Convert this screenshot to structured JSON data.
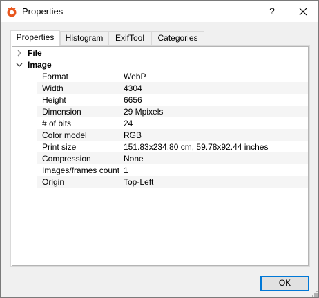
{
  "window": {
    "title": "Properties",
    "help_label": "?"
  },
  "tabs": [
    {
      "label": "Properties"
    },
    {
      "label": "Histogram"
    },
    {
      "label": "ExifTool"
    },
    {
      "label": "Categories"
    }
  ],
  "groups": [
    {
      "label": "File",
      "expanded": false
    },
    {
      "label": "Image",
      "expanded": true
    }
  ],
  "properties": [
    {
      "key": "Format",
      "value": "WebP"
    },
    {
      "key": "Width",
      "value": "4304"
    },
    {
      "key": "Height",
      "value": "6656"
    },
    {
      "key": "Dimension",
      "value": "29 Mpixels"
    },
    {
      "key": "# of bits",
      "value": "24"
    },
    {
      "key": "Color model",
      "value": "RGB"
    },
    {
      "key": "Print size",
      "value": "151.83x234.80 cm, 59.78x92.44 inches"
    },
    {
      "key": "Compression",
      "value": "None"
    },
    {
      "key": "Images/frames count",
      "value": "1"
    },
    {
      "key": "Origin",
      "value": "Top-Left"
    }
  ],
  "footer": {
    "ok_label": "OK"
  },
  "colors": {
    "accent": "#0078d7",
    "alt_row": "#f5f5f5",
    "border": "#d9d9d9"
  },
  "icons": [
    "app-icon",
    "chevron-right-icon",
    "chevron-down-icon",
    "close-icon",
    "size-grip-icon"
  ]
}
